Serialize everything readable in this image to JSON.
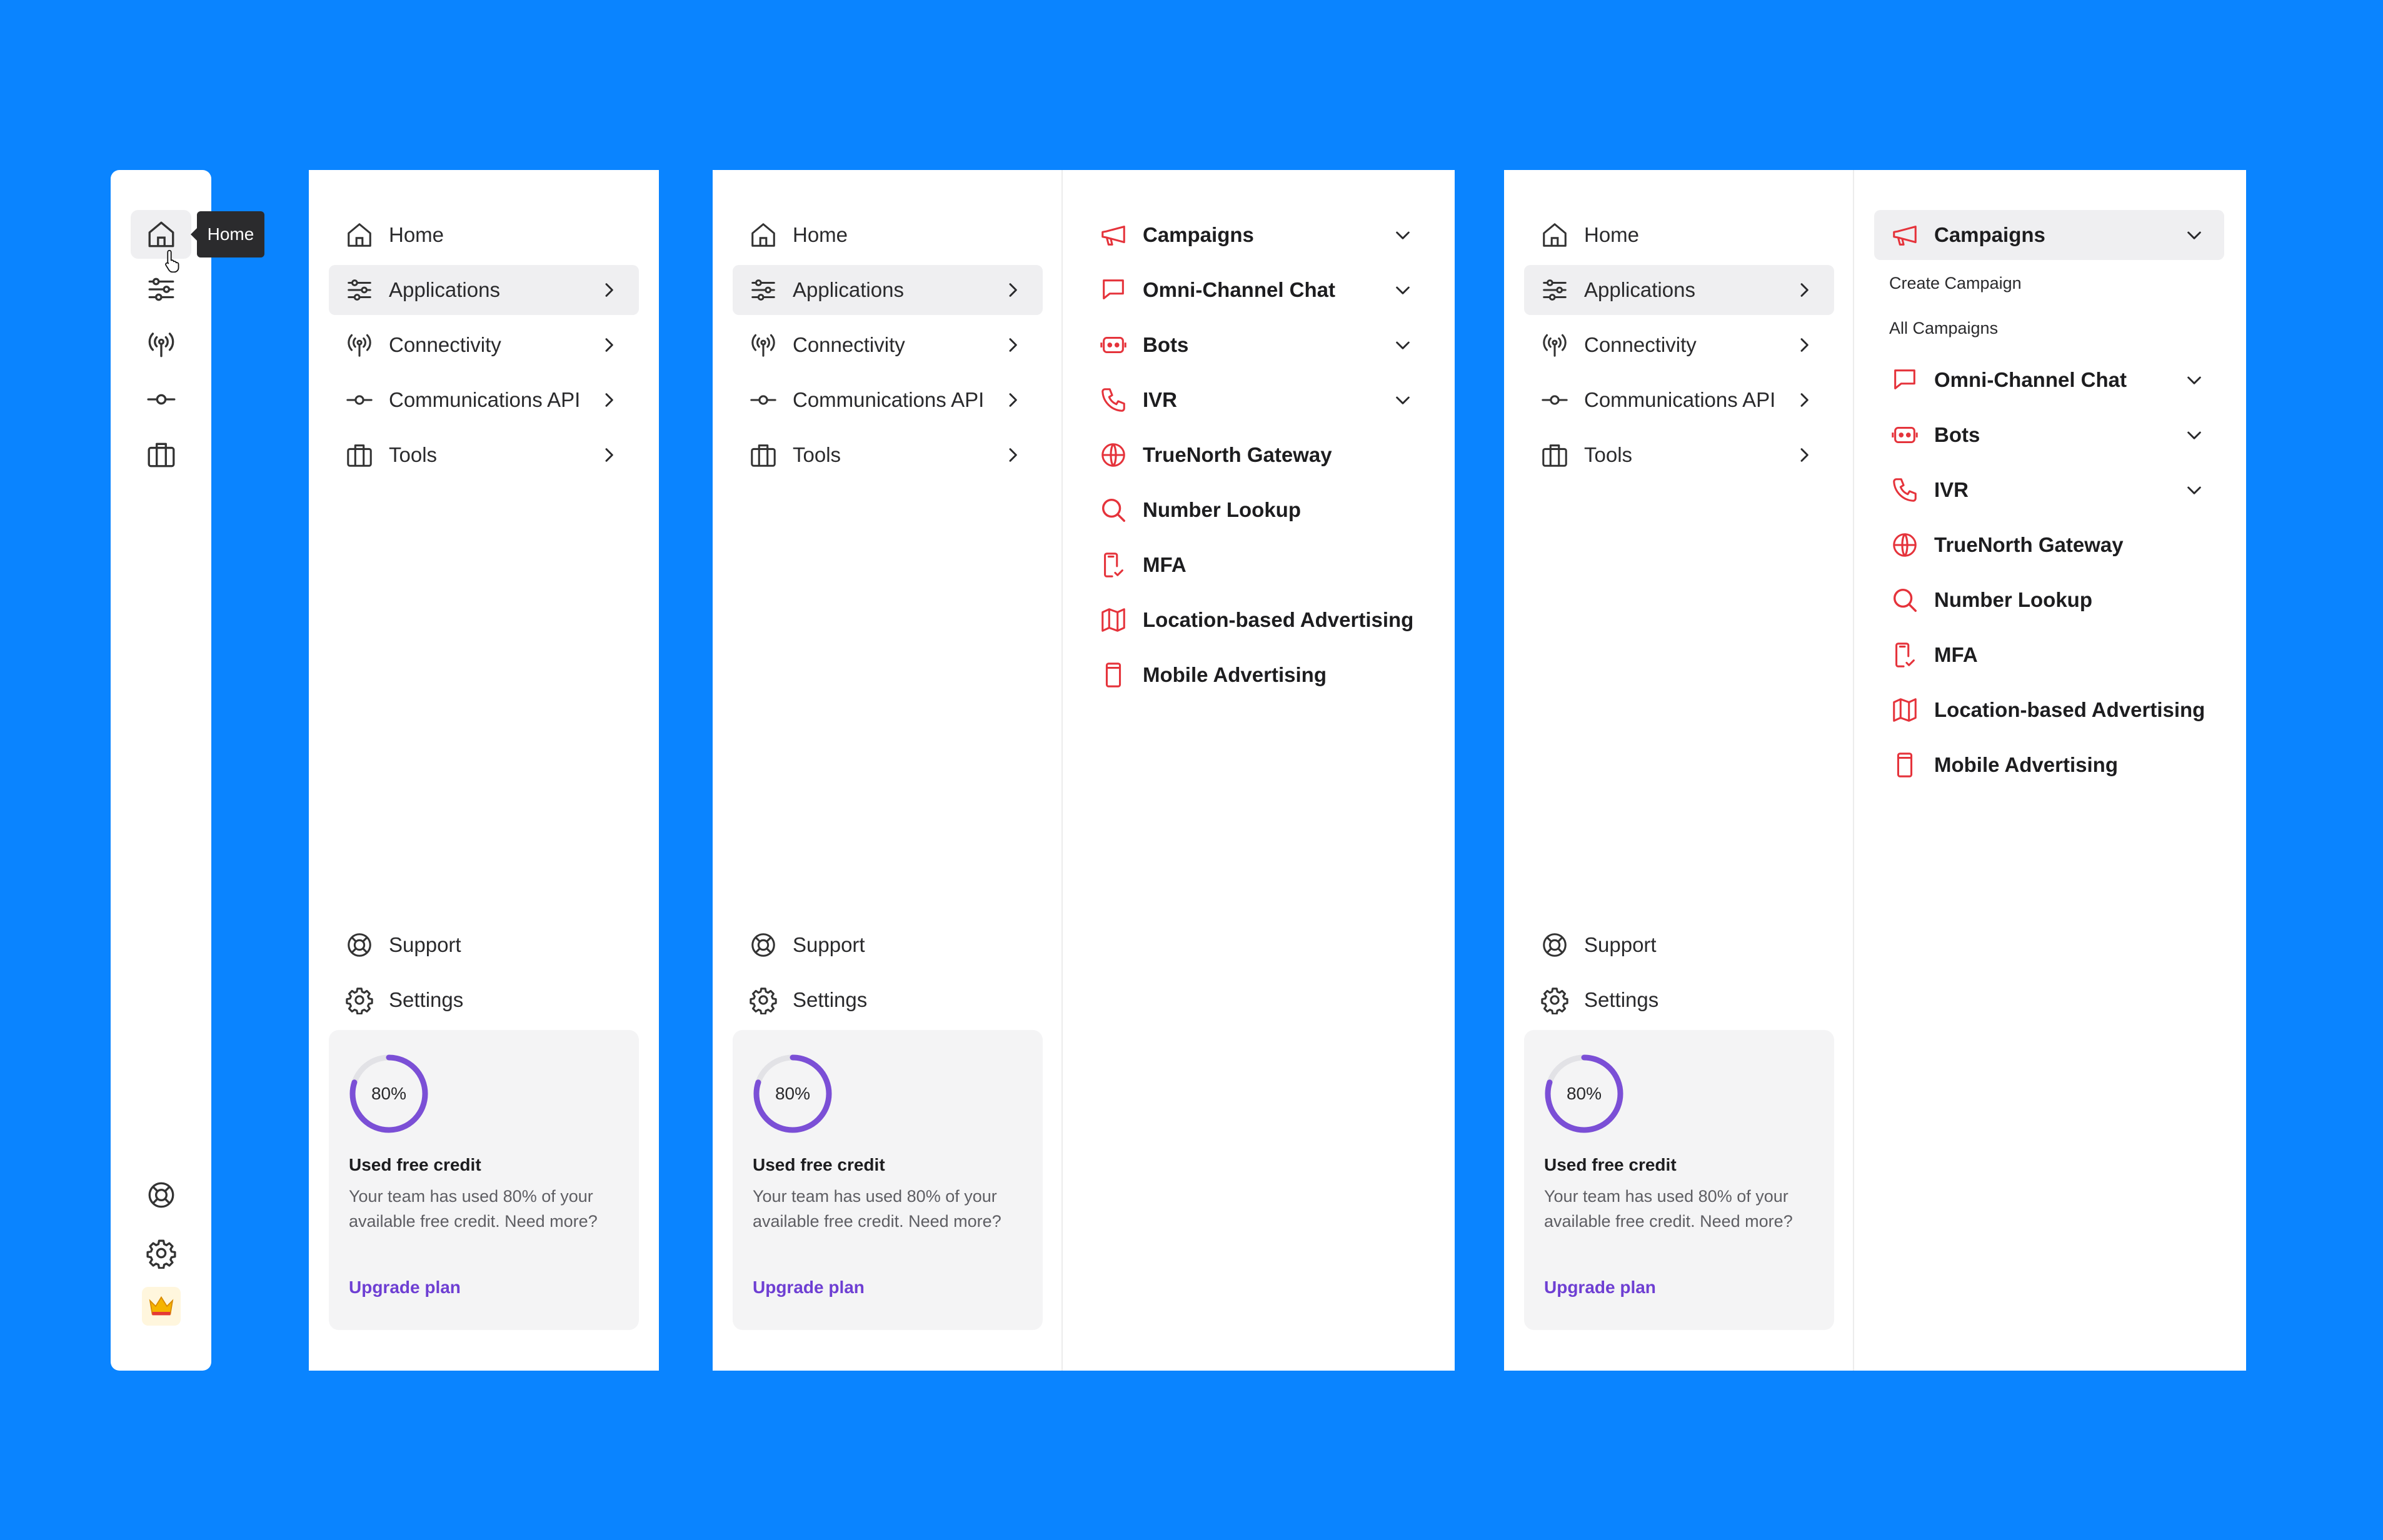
{
  "rail": {
    "tooltip": "Home",
    "icons": [
      "home-icon",
      "sliders-icon",
      "antenna-icon",
      "commit-icon",
      "briefcase-icon",
      "lifebuoy-icon",
      "gear-icon",
      "crown-icon"
    ]
  },
  "nav": {
    "items": [
      {
        "label": "Home",
        "icon": "home-icon"
      },
      {
        "label": "Applications",
        "icon": "sliders-icon"
      },
      {
        "label": "Connectivity",
        "icon": "antenna-icon"
      },
      {
        "label": "Communications API",
        "icon": "commit-icon"
      },
      {
        "label": "Tools",
        "icon": "briefcase-icon"
      }
    ],
    "footer": [
      {
        "label": "Support",
        "icon": "lifebuoy-icon"
      },
      {
        "label": "Settings",
        "icon": "gear-icon"
      }
    ]
  },
  "credit": {
    "percent_text": "80%",
    "percent": 80,
    "title": "Used free credit",
    "description": "Your team has used 80% of your available free credit. Need more?",
    "link": "Upgrade plan"
  },
  "applications": {
    "items": [
      {
        "label": "Campaigns",
        "icon": "megaphone-icon"
      },
      {
        "label": "Omni-Channel Chat",
        "icon": "chat-bubble-icon"
      },
      {
        "label": "Bots",
        "icon": "bot-icon"
      },
      {
        "label": "IVR",
        "icon": "phone-icon"
      },
      {
        "label": "TrueNorth Gateway",
        "icon": "globe-icon"
      },
      {
        "label": "Number Lookup",
        "icon": "search-icon"
      },
      {
        "label": "MFA",
        "icon": "mobile-check-icon"
      },
      {
        "label": "Location-based Advertising",
        "icon": "map-icon"
      },
      {
        "label": "Mobile Advertising",
        "icon": "mobile-icon"
      }
    ],
    "campaign_links": [
      "Create Campaign",
      "All Campaigns"
    ]
  },
  "colors": {
    "background": "#0A84FF",
    "accent_red": "#E5333B",
    "accent_purple": "#6E3FD3",
    "active_bg": "#EFEFF1"
  }
}
